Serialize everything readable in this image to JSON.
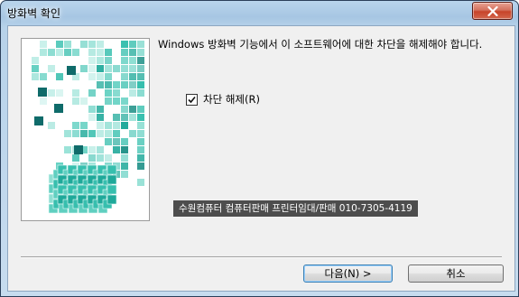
{
  "window": {
    "title": "방화벽 확인",
    "close_label": "✕"
  },
  "banner": {
    "image": "teal-cube-grid-illustration"
  },
  "message": "Windows 방화벽 기능에서 이 소프트웨어에 대한 차단을 해제해야 합니다.",
  "unblock_checkbox": {
    "label": "차단 해제(R)",
    "checked": true
  },
  "watermark": "수원컴퓨터 컴퓨터판매 프린터임대/판매 010-7305-4119",
  "buttons": {
    "next": "다음(N) >",
    "cancel": "취소"
  },
  "colors": {
    "title_bar": "#a7c6e3",
    "close_button": "#c7442a",
    "client_background": "#f0f0f0",
    "banner_teal": "#2fbfb0"
  },
  "icons": {
    "close": "close-icon",
    "checkmark": "checkmark-icon"
  }
}
